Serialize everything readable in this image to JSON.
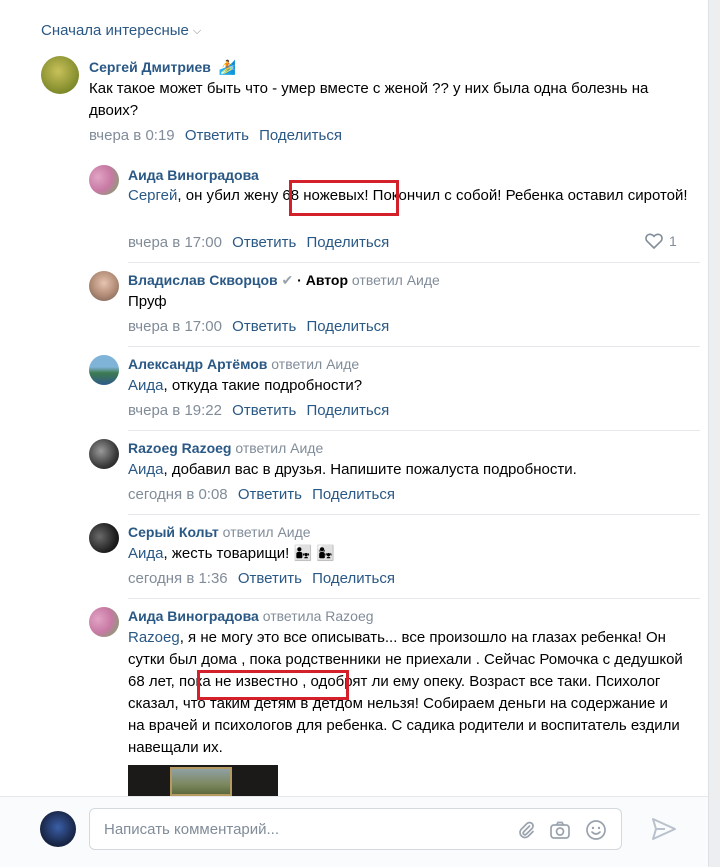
{
  "sort_label": "Сначала интересные",
  "comments": [
    {
      "author": "Сергей Дмитриев",
      "text": "Как такое может быть что - умер вместе с женой ?? у них была одна болезнь на двоих?",
      "time": "вчера в 0:19",
      "reply": "Ответить",
      "share": "Поделиться"
    },
    {
      "author": "Аида Виноградова",
      "mention": "Сергей",
      "text_a": ", он убил жену ",
      "highlight": "68 ножевых!",
      "text_b": " Покончил с собой! Ребенка оставил сиротой!",
      "time": "вчера в 17:00",
      "reply": "Ответить",
      "share": "Поделиться",
      "likes": "1"
    },
    {
      "author": "Владислав Скворцов",
      "author_tag": "· Автор",
      "replied_to": "ответил Аиде",
      "text": "Пруф",
      "time": "вчера в 17:00",
      "reply": "Ответить",
      "share": "Поделиться"
    },
    {
      "author": "Александр Артёмов",
      "replied_to": "ответил Аиде",
      "mention": "Аида",
      "text": ", откуда такие подробности?",
      "time": "вчера в 19:22",
      "reply": "Ответить",
      "share": "Поделиться"
    },
    {
      "author": "Razoeg Razoeg",
      "replied_to": "ответил Аиде",
      "mention": "Аида",
      "text": ", добавил вас в друзья. Напишите пожалуста подробности.",
      "time": "сегодня в 0:08",
      "reply": "Ответить",
      "share": "Поделиться"
    },
    {
      "author": "Серый Кольт",
      "replied_to": "ответил Аиде",
      "mention": "Аида",
      "text": ", жесть товарищи! 👨‍👧 👩‍👧",
      "time": "сегодня в 1:36",
      "reply": "Ответить",
      "share": "Поделиться"
    },
    {
      "author": "Аида Виноградова",
      "replied_to": "ответила Razoeg",
      "mention": "Razoeg",
      "text_a": ", я не могу это все описывать... все произошло на глазах ребенка! Он сутки был дома , пока родственники не приехали . Сейчас Ромочка ",
      "highlight": "с дедушкой 68 лет",
      "text_b": ", пока не известно , одобрят ли ему опеку. Возраст все таки. Психолог сказал, что таким детям в детдом нельзя! Собираем деньги на содержание и на врачей и психологов для ребенка. С садика родители и воспитатель ездили навещали их."
    }
  ],
  "composer": {
    "placeholder": "Написать комментарий..."
  }
}
